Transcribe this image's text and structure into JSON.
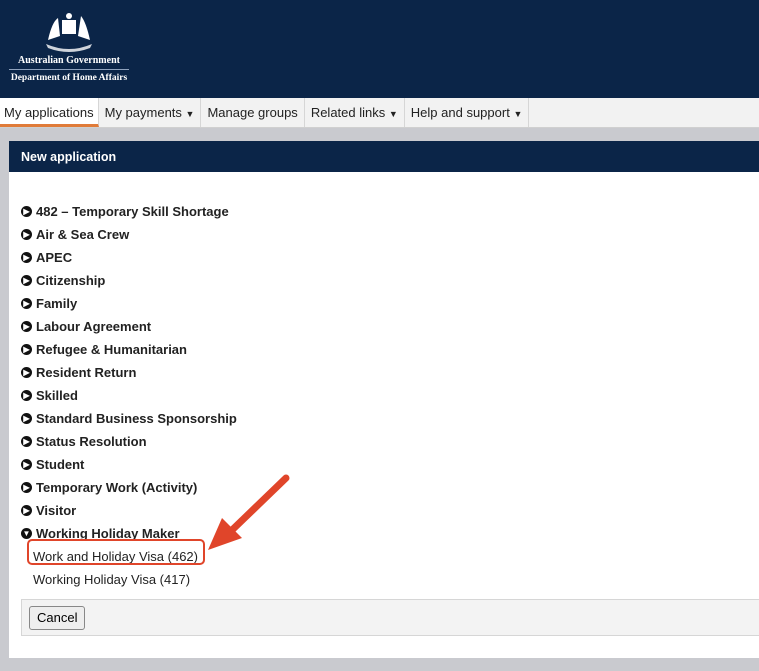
{
  "header": {
    "gov": "Australian Government",
    "dept": "Department of Home Affairs"
  },
  "nav": [
    {
      "label": "My applications",
      "active": true
    },
    {
      "label": "My payments",
      "dropdown": true
    },
    {
      "label": "Manage groups"
    },
    {
      "label": "Related links",
      "dropdown": true
    },
    {
      "label": "Help and support",
      "dropdown": true
    }
  ],
  "panel": {
    "title": "New application",
    "categories": [
      "482 – Temporary Skill Shortage",
      "Air & Sea Crew",
      "APEC",
      "Citizenship",
      "Family",
      "Labour Agreement",
      "Refugee & Humanitarian",
      "Resident Return",
      "Skilled",
      "Standard Business Sponsorship",
      "Status Resolution",
      "Student",
      "Temporary Work (Activity)",
      "Visitor",
      "Working Holiday Maker"
    ],
    "expanded": "Working Holiday Maker",
    "subitems": [
      "Work and Holiday Visa (462)",
      "Working Holiday Visa (417)"
    ],
    "cancel": "Cancel"
  },
  "colors": {
    "navy": "#0b2548",
    "accent": "#e07b39",
    "annotation": "#e0452a"
  }
}
